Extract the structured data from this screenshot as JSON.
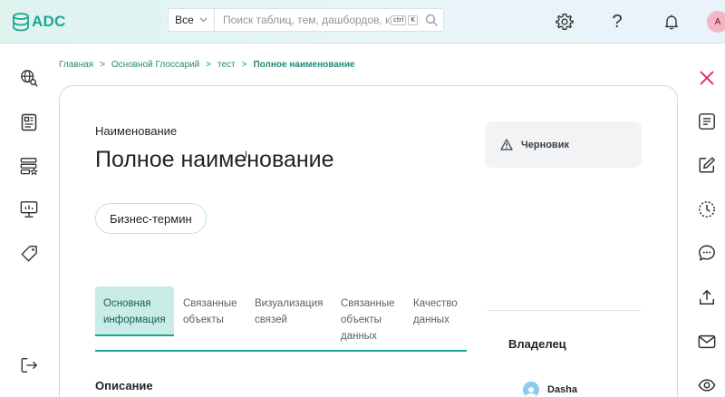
{
  "logo": {
    "text": "ADC"
  },
  "search": {
    "scope": "Все",
    "placeholder": "Поиск таблиц, тем, дашбордов, ко",
    "shortcut_ctrl": "ctrl",
    "shortcut_key": "K"
  },
  "header_icons": [
    "gear-icon",
    "help-icon",
    "bell-icon"
  ],
  "help_glyph": "?",
  "user": {
    "initial": "A"
  },
  "left_sidebar": [
    "globe-search-icon",
    "catalog-icon",
    "database-star-icon",
    "monitor-chart-icon",
    "tag-icon",
    "logout-icon"
  ],
  "right_sidebar": [
    "close-icon",
    "document-list-icon",
    "edit-icon",
    "history-icon",
    "comment-icon",
    "upload-icon",
    "mail-icon",
    "eye-icon"
  ],
  "breadcrumb": {
    "items": [
      "Главная",
      "Основной Глоссарий",
      "тест"
    ],
    "separator": ">",
    "current": "Полное наименование"
  },
  "term": {
    "name_label": "Наименование",
    "title": "Полное наименование",
    "type_chip": "Бизнес-термин"
  },
  "status": {
    "label": "Черновик"
  },
  "tabs": [
    {
      "line1": "Основная",
      "line2": "информация",
      "line3": ""
    },
    {
      "line1": "Связанные",
      "line2": "объекты",
      "line3": ""
    },
    {
      "line1": "Визуализация",
      "line2": "связей",
      "line3": ""
    },
    {
      "line1": "Связанные",
      "line2": "объекты",
      "line3": "данных"
    },
    {
      "line1": "Качество",
      "line2": "данных",
      "line3": ""
    }
  ],
  "active_tab": 0,
  "owner": {
    "label": "Владелец",
    "name": "Dasha"
  },
  "description": {
    "label": "Описание"
  },
  "colors": {
    "accent": "#1aa890",
    "active_tab_bg": "#c9ede6",
    "close": "#e0265e",
    "card_border": "#bfe4de"
  }
}
